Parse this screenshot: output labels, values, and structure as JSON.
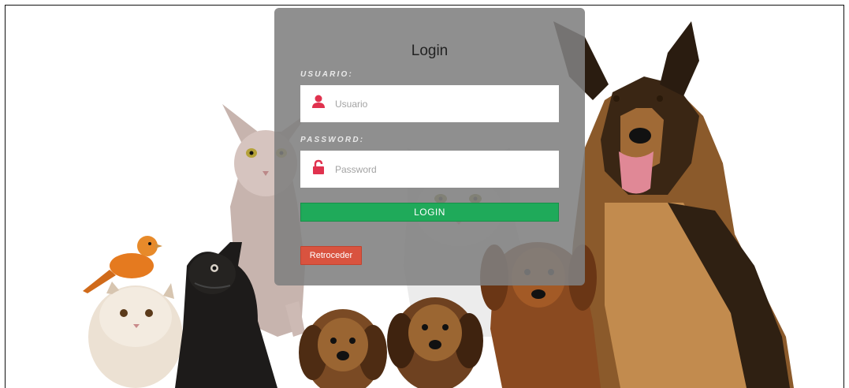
{
  "login": {
    "title": "Login",
    "username_label": "USUARIO:",
    "username_placeholder": "Usuario",
    "password_label": "PASSWORD:",
    "password_placeholder": "Password",
    "login_button": "LOGIN",
    "back_button": "Retroceder"
  },
  "icons": {
    "username": "user-icon",
    "password": "unlock-icon"
  },
  "background": {
    "description_icon": "pets-photo",
    "animals": [
      "canary",
      "persian-kitten",
      "rabbit",
      "sphynx-cat",
      "white-cat",
      "puppy",
      "puppy",
      "dachshund",
      "german-shepherd"
    ]
  },
  "colors": {
    "panel": "#808080",
    "login_button": "#1faa5a",
    "back_button": "#d9533f",
    "icon_accent": "#e0324e"
  }
}
